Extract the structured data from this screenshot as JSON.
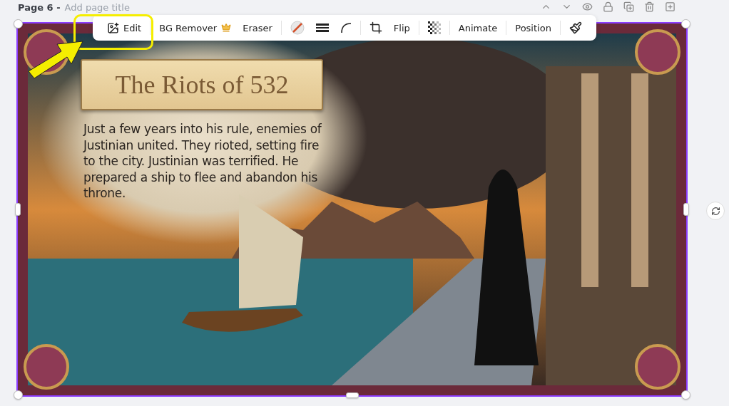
{
  "page": {
    "label": "Page 6 -",
    "title_placeholder": "Add page title"
  },
  "toolbar": {
    "groups": [
      [
        {
          "kind": "edit",
          "label": "Edit"
        }
      ],
      [
        {
          "kind": "premium",
          "label": "BG Remover"
        },
        {
          "kind": "text",
          "label": "Eraser"
        }
      ],
      [
        {
          "kind": "border-color"
        },
        {
          "kind": "border-style"
        },
        {
          "kind": "corner"
        }
      ],
      [
        {
          "kind": "crop"
        },
        {
          "kind": "text",
          "label": "Flip"
        }
      ],
      [
        {
          "kind": "transparency"
        }
      ],
      [
        {
          "kind": "text",
          "label": "Animate"
        }
      ],
      [
        {
          "kind": "text",
          "label": "Position"
        }
      ],
      [
        {
          "kind": "paint"
        }
      ]
    ]
  },
  "slide": {
    "selected": true,
    "title": "The Riots of 532",
    "body": "Just a few years into his rule, enemies of Justinian united. They rioted, setting fire to the city. Justinian was terrified. He prepared a ship to flee and abandon his throne."
  }
}
